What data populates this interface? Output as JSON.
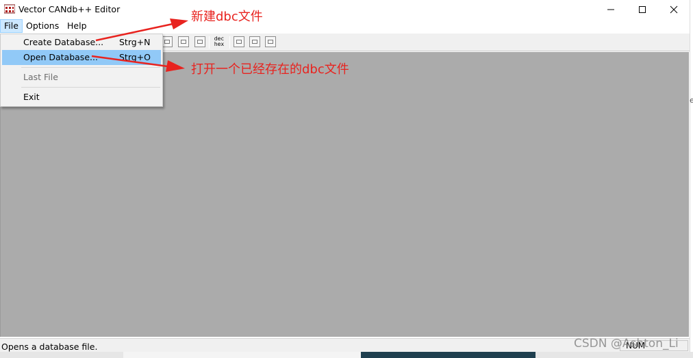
{
  "window": {
    "title": "Vector CANdb++ Editor",
    "app_icon": "candb-app-icon",
    "controls": {
      "minimize": "─",
      "maximize": "☐",
      "close": "✕"
    }
  },
  "menubar": {
    "items": [
      "File",
      "Options",
      "Help"
    ]
  },
  "file_menu": {
    "create": {
      "label": "Create Database...",
      "shortcut": "Strg+N"
    },
    "open": {
      "label": "Open Database...",
      "shortcut": "Strg+O"
    },
    "last": {
      "label": "Last File"
    },
    "exit": {
      "label": "Exit"
    }
  },
  "toolbar": {
    "dec_hex_top": "dec",
    "dec_hex_bottom": "hex"
  },
  "annotations": {
    "new_dbc": "新建dbc文件",
    "open_dbc": "打开一个已经存在的dbc文件",
    "color": "#e8231f"
  },
  "statusbar": {
    "message": "Opens a database file.",
    "num": "NUM"
  },
  "side_mark": "eF",
  "watermark": "CSDN @Ashton_Li"
}
